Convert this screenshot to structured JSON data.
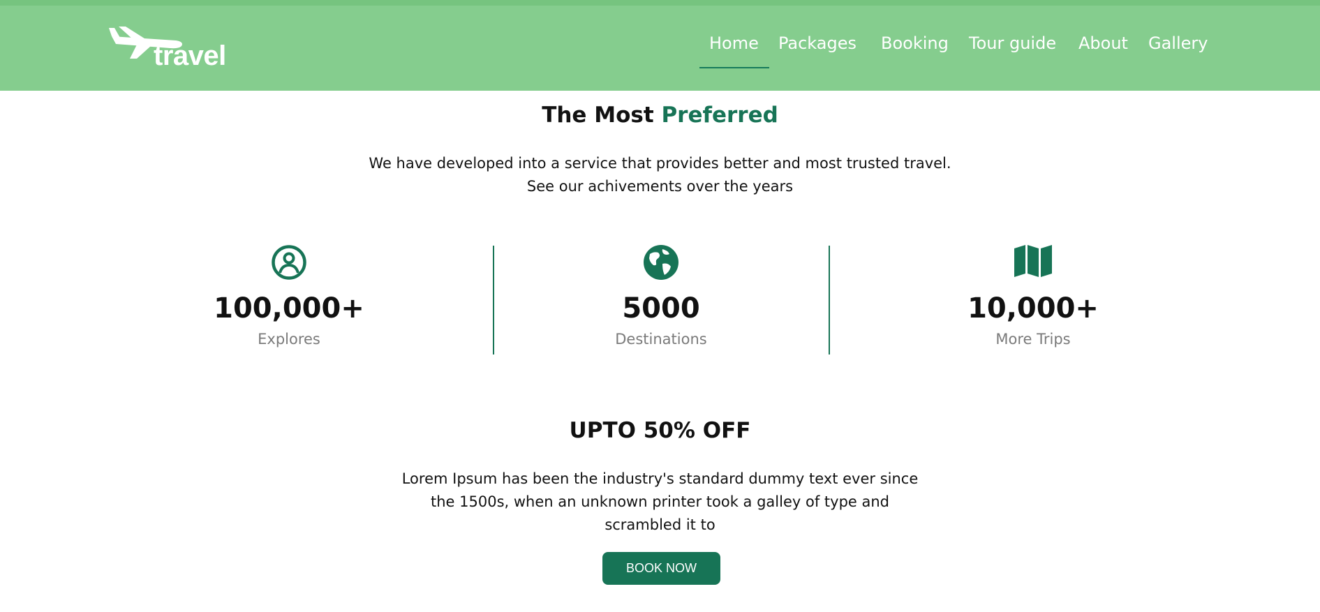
{
  "header": {
    "logo_text": "travel",
    "nav": [
      {
        "label": "Home",
        "active": true
      },
      {
        "label": "Packages"
      },
      {
        "label": "Booking"
      },
      {
        "label": "Tour guide"
      },
      {
        "label": "About"
      },
      {
        "label": "Gallery"
      }
    ]
  },
  "preferred": {
    "title_plain": "The Most",
    "title_accent": "Preferred",
    "line1": "We have developed into a service that provides better and most trusted travel.",
    "line2": "See our achivements over the years"
  },
  "stats": [
    {
      "icon": "user-circle-icon",
      "value": "100,000+",
      "label": "Explores"
    },
    {
      "icon": "globe-icon",
      "value": "5000",
      "label": "Destinations"
    },
    {
      "icon": "map-icon",
      "value": "10,000+",
      "label": "More Trips"
    }
  ],
  "offer": {
    "title": "UPTO 50% OFF",
    "line1": "Lorem Ipsum has been the industry's standard dummy text ever since",
    "line2": "the 1500s, when an unknown printer took a galley of type and",
    "line3": "scrambled it to",
    "button_label": "BOOK NOW"
  },
  "colors": {
    "header_bg": "#85cd8e",
    "accent": "#177456",
    "muted_text": "#7a7a7a"
  }
}
